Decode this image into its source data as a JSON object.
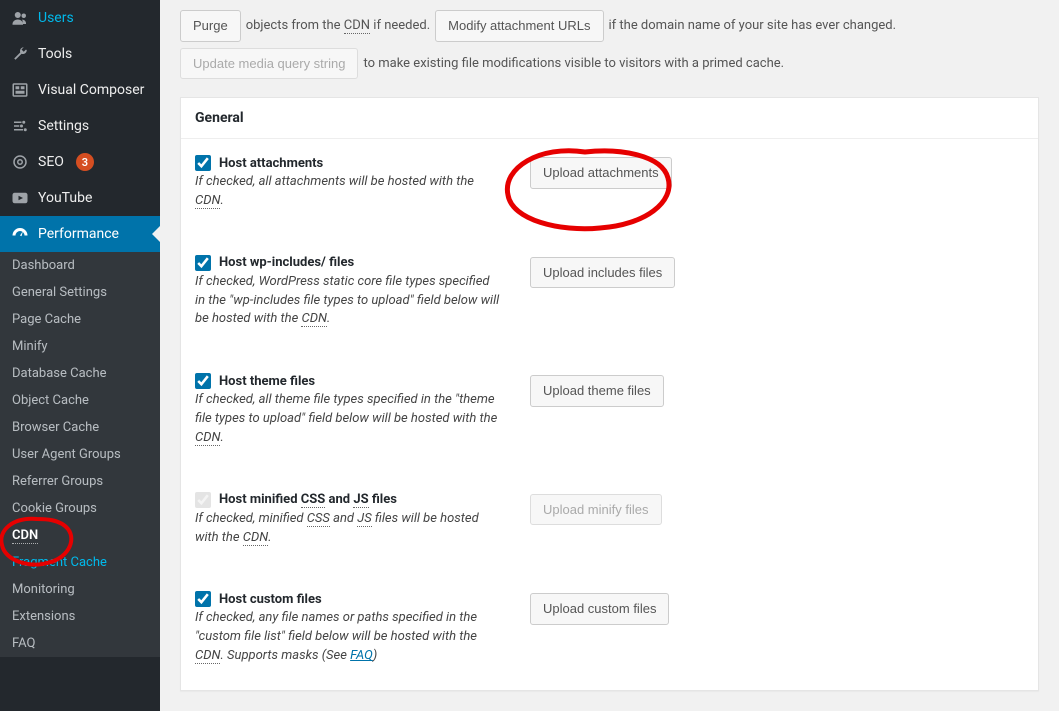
{
  "sidebar": {
    "top": [
      {
        "icon": "users",
        "label": "Users"
      },
      {
        "icon": "wrench",
        "label": "Tools"
      },
      {
        "icon": "visual",
        "label": "Visual Composer"
      },
      {
        "icon": "sliders",
        "label": "Settings"
      },
      {
        "icon": "seo",
        "label": "SEO",
        "badge": "3"
      },
      {
        "icon": "youtube",
        "label": "YouTube"
      },
      {
        "icon": "gauge",
        "label": "Performance",
        "active": true
      }
    ],
    "sub": [
      {
        "label": "Dashboard"
      },
      {
        "label": "General Settings"
      },
      {
        "label": "Page Cache"
      },
      {
        "label": "Minify"
      },
      {
        "label": "Database Cache"
      },
      {
        "label": "Object Cache"
      },
      {
        "label": "Browser Cache"
      },
      {
        "label": "User Agent Groups"
      },
      {
        "label": "Referrer Groups"
      },
      {
        "label": "Cookie Groups"
      },
      {
        "label": "CDN",
        "current": true
      },
      {
        "label": "Fragment Cache",
        "teal": true
      },
      {
        "label": "Monitoring"
      },
      {
        "label": "Extensions"
      },
      {
        "label": "FAQ"
      }
    ]
  },
  "topbar": {
    "purge_btn": "Purge",
    "purge_text1": "objects from the ",
    "purge_cdn": "CDN",
    "purge_text2": " if needed.",
    "modify_btn": "Modify attachment URLs",
    "modify_text": "if the domain name of your site has ever changed.",
    "update_btn": "Update media query string",
    "update_text": "to make existing file modifications visible to visitors with a primed cache."
  },
  "panel": {
    "title": "General",
    "rows": [
      {
        "title": "Host attachments",
        "desc_pre": "If checked, all attachments will be hosted with the ",
        "desc_abbr": "CDN",
        "desc_post": ".",
        "btn": "Upload attachments",
        "btn_disabled": false,
        "checked": true
      },
      {
        "title": "Host wp-includes/ files",
        "desc_pre": "If checked, WordPress static core file types specified in the \"wp-includes file types to upload\" field below will be hosted with the ",
        "desc_abbr": "CDN",
        "desc_post": ".",
        "btn": "Upload includes files",
        "btn_disabled": false,
        "checked": true
      },
      {
        "title": "Host theme files",
        "desc_pre": "If checked, all theme file types specified in the \"theme file types to upload\" field below will be hosted with the ",
        "desc_abbr": "CDN",
        "desc_post": ".",
        "btn": "Upload theme files",
        "btn_disabled": false,
        "checked": true
      },
      {
        "title_pre": "Host minified ",
        "title_abbr1": "CSS",
        "title_mid": " and ",
        "title_abbr2": "JS",
        "title_post": " files",
        "desc_pre": "If checked, minified ",
        "desc_abbr": "CSS",
        "desc_mid": " and ",
        "desc_abbr2": "JS",
        "desc_post2": " files will be hosted with the ",
        "desc_abbr3": "CDN",
        "desc_end": ".",
        "btn": "Upload minify files",
        "btn_disabled": true,
        "checked": true,
        "checked_disabled": true
      },
      {
        "title": "Host custom files",
        "desc_pre": "If checked, any file names or paths specified in the \"custom file list\" field below will be hosted with the ",
        "desc_abbr": "CDN",
        "desc_post": ". Supports masks (See ",
        "faq": "FAQ",
        "desc_end": ")",
        "btn": "Upload custom files",
        "btn_disabled": false,
        "checked": true
      }
    ]
  }
}
